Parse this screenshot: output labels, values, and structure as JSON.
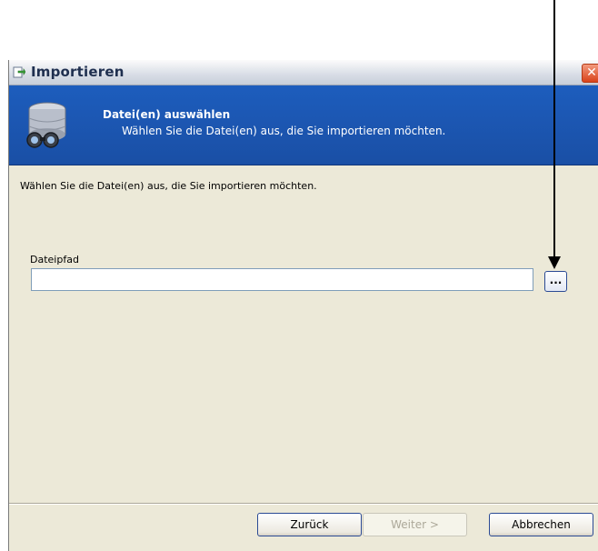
{
  "window": {
    "title": "Importieren"
  },
  "banner": {
    "title": "Datei(en) auswählen",
    "subtitle": "Wählen Sie die Datei(en) aus, die Sie importieren möchten."
  },
  "body": {
    "instructions": "Wählen Sie die Datei(en) aus, die Sie importieren möchten.",
    "path_label": "Dateipfad",
    "path_value": "",
    "browse_label": "..."
  },
  "footer": {
    "back_label": "Zurück",
    "next_label": "Weiter >",
    "cancel_label": "Abbrechen"
  },
  "icons": {
    "title_icon": "import-icon",
    "banner_icon": "database-search-icon",
    "close_icon": "close-icon"
  },
  "colors": {
    "banner": "#1d5dbd",
    "window_bg": "#ece9d8",
    "close": "#d9431a"
  }
}
